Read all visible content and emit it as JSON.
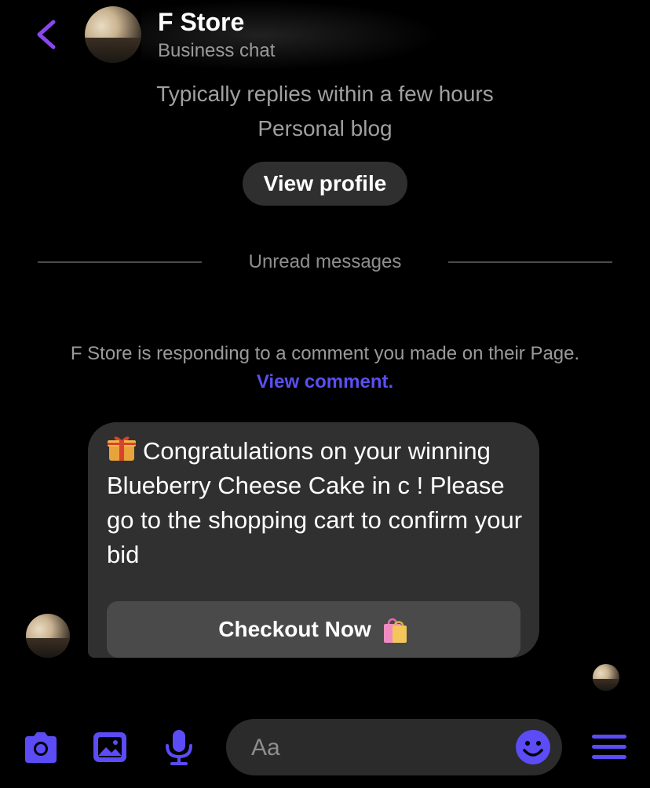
{
  "header": {
    "title": "F Store",
    "subtitle": "Business chat"
  },
  "profile_info": {
    "reply_time": "Typically replies within a few hours",
    "category": "Personal blog",
    "view_profile_label": "View profile"
  },
  "divider": {
    "label": "Unread messages"
  },
  "context_notice": {
    "text": "F Store is responding to a comment you made on their Page.",
    "link_label": "View comment."
  },
  "message": {
    "text": "Congratulations on your winning Blueberry Cheese Cake in c ! Please go to the shopping cart to confirm your bid",
    "button_label": "Checkout Now",
    "leading_icon": "gift-icon",
    "button_icon": "shopping-bags-icon"
  },
  "composer": {
    "placeholder": "Aa",
    "icons": [
      "camera-icon",
      "photo-icon",
      "microphone-icon",
      "emoji-icon",
      "menu-icon"
    ]
  },
  "colors": {
    "accent": "#5b4cf5",
    "back_chevron": "#8b46f0",
    "background": "#000000",
    "bubble": "#303030"
  }
}
